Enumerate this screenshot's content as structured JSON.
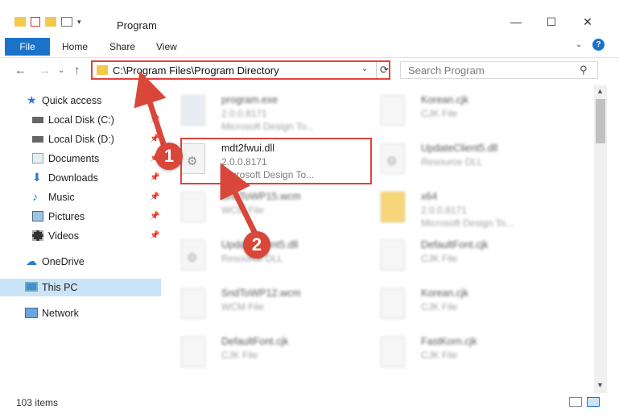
{
  "window": {
    "title": "Program",
    "minimize": "—",
    "maximize": "☐",
    "close": "✕"
  },
  "ribbon": {
    "tabs": [
      "File",
      "Home",
      "Share",
      "View"
    ],
    "help": "?"
  },
  "address": {
    "path": "C:\\Program Files\\Program Directory",
    "dropdown": "⌄",
    "refresh": "⟳"
  },
  "search": {
    "placeholder": "Search Program",
    "icon": "⚲"
  },
  "nav_buttons": {
    "back": "←",
    "forward": "→",
    "recent": "⌄",
    "up": "↑"
  },
  "sidebar": {
    "items": [
      {
        "label": "Quick access",
        "icon": "star-icon",
        "color": "#2b7cd3"
      },
      {
        "label": "Local Disk (C:)",
        "icon": "drive-icon",
        "pinned": true
      },
      {
        "label": "Local Disk (D:)",
        "icon": "drive-icon",
        "pinned": true
      },
      {
        "label": "Documents",
        "icon": "documents-icon",
        "pinned": true
      },
      {
        "label": "Downloads",
        "icon": "download-icon",
        "pinned": true
      },
      {
        "label": "Music",
        "icon": "music-icon",
        "pinned": true
      },
      {
        "label": "Pictures",
        "icon": "pictures-icon",
        "pinned": true
      },
      {
        "label": "Videos",
        "icon": "videos-icon",
        "pinned": true
      },
      {
        "label": "OneDrive",
        "icon": "cloud-icon"
      },
      {
        "label": "This PC",
        "icon": "computer-icon",
        "selected": true
      },
      {
        "label": "Network",
        "icon": "network-icon"
      }
    ],
    "pin": "📌"
  },
  "files": [
    {
      "name": "program.exe",
      "line2": "2.0.0.8171",
      "line3": "Microsoft Design To..."
    },
    {
      "name": "Korean.cjk",
      "line2": "CJK File",
      "line3": ""
    },
    {
      "name": "mdt2fwui.dll",
      "line2": "2.0.0.8171",
      "line3": "Microsoft Design To..."
    },
    {
      "name": "UpdateClient5.dll",
      "line2": "Resource DLL",
      "line3": ""
    },
    {
      "name": "SndToWP15.wcm",
      "line2": "WCM File",
      "line3": ""
    },
    {
      "name": "x64",
      "line2": "2.0.0.8171",
      "line3": "Microsoft Design To..."
    },
    {
      "name": "UpdateClient5.dll",
      "line2": "Resource DLL",
      "line3": ""
    },
    {
      "name": "DefaultFont.cjk",
      "line2": "CJK File",
      "line3": ""
    },
    {
      "name": "SndToWP12.wcm",
      "line2": "WCM File",
      "line3": ""
    },
    {
      "name": "Korean.cjk",
      "line2": "CJK File",
      "line3": ""
    },
    {
      "name": "DefaultFont.cjk",
      "line2": "CJK File",
      "line3": ""
    },
    {
      "name": "FastKorn.cjk",
      "line2": "CJK File",
      "line3": ""
    }
  ],
  "annotations": {
    "step1": "1",
    "step2": "2",
    "color": "#d9473a"
  },
  "status": {
    "item_count": "103 items"
  }
}
